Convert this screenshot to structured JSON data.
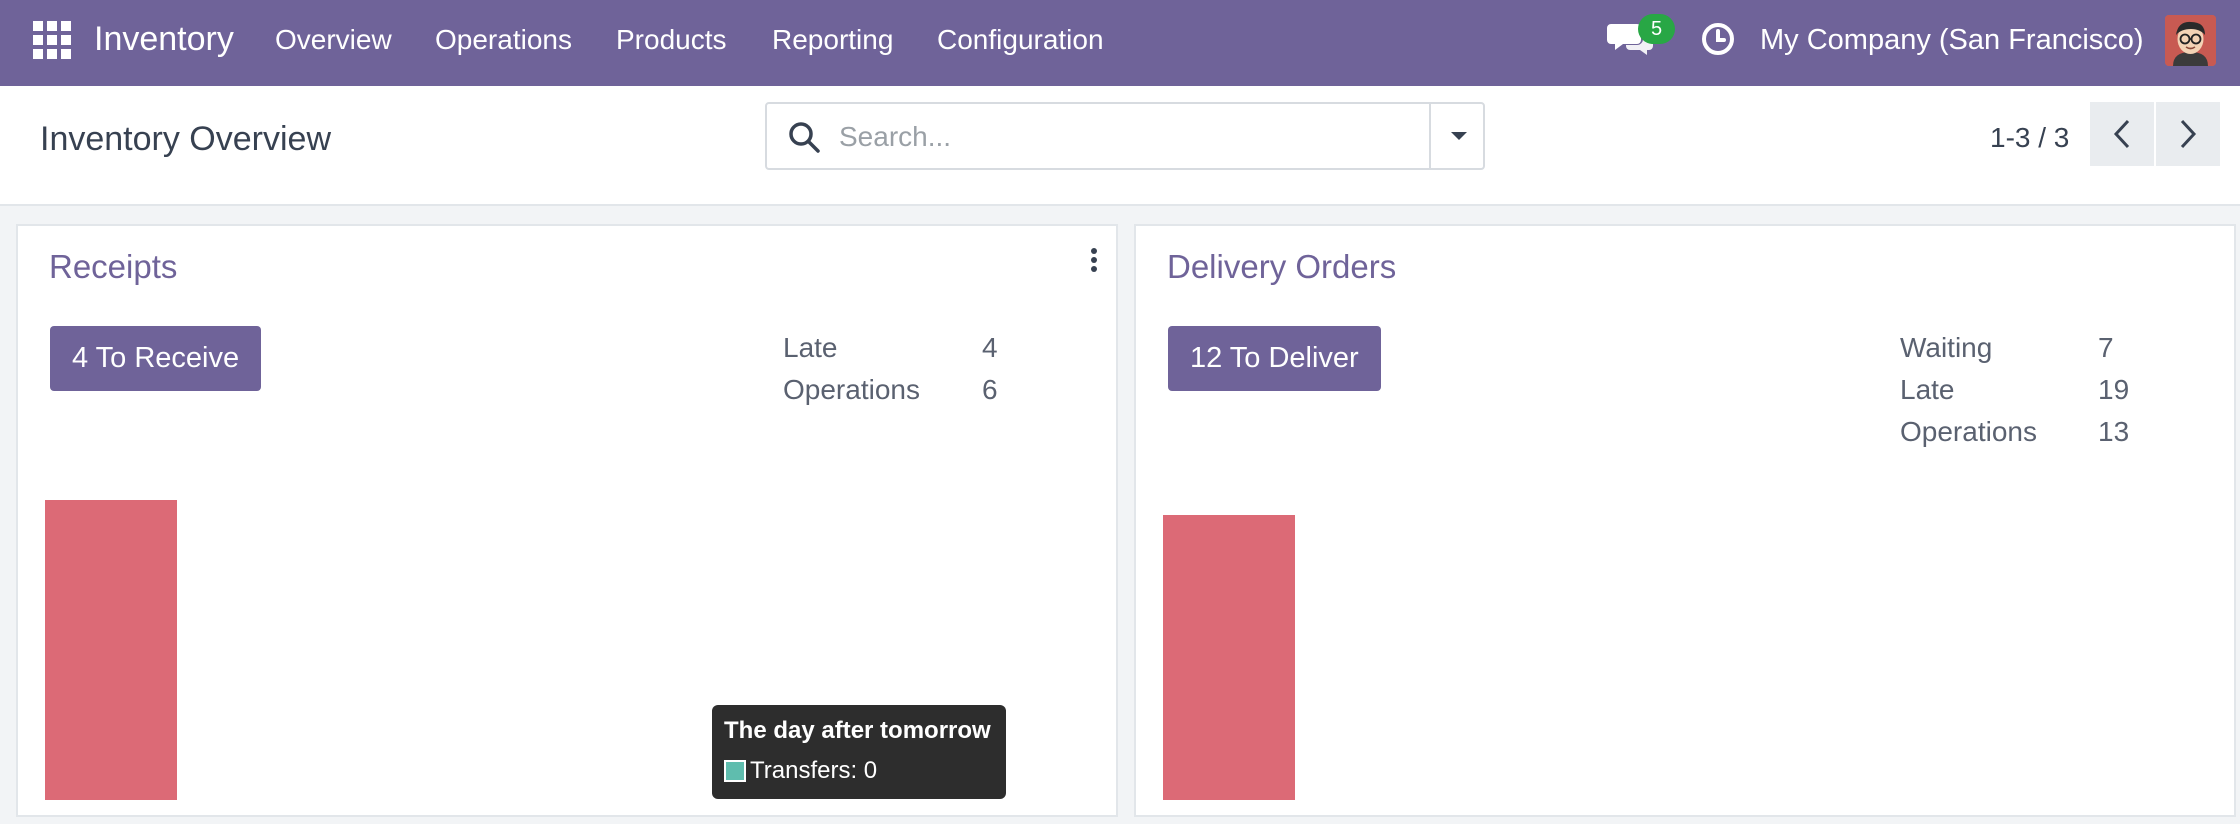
{
  "navbar": {
    "app_name": "Inventory",
    "menu": [
      {
        "label": "Overview"
      },
      {
        "label": "Operations"
      },
      {
        "label": "Products"
      },
      {
        "label": "Reporting"
      },
      {
        "label": "Configuration"
      }
    ],
    "messages_count": "5",
    "company": "My Company (San Francisco)",
    "brand_color": "#6f6399"
  },
  "control": {
    "title": "Inventory Overview",
    "search_placeholder": "Search...",
    "pager": "1-3 / 3"
  },
  "cards": [
    {
      "title": "Receipts",
      "button": "4 To Receive",
      "stats": [
        {
          "label": "Late",
          "value": "4"
        },
        {
          "label": "Operations",
          "value": "6"
        }
      ]
    },
    {
      "title": "Delivery Orders",
      "button": "12 To Deliver",
      "stats": [
        {
          "label": "Waiting",
          "value": "7"
        },
        {
          "label": "Late",
          "value": "19"
        },
        {
          "label": "Operations",
          "value": "13"
        }
      ]
    }
  ],
  "tooltip": {
    "title": "The day after tomorrow",
    "row": "Transfers: 0",
    "swatch_color": "#5fbdae"
  },
  "colors": {
    "late_bar": "#dc6a76"
  }
}
